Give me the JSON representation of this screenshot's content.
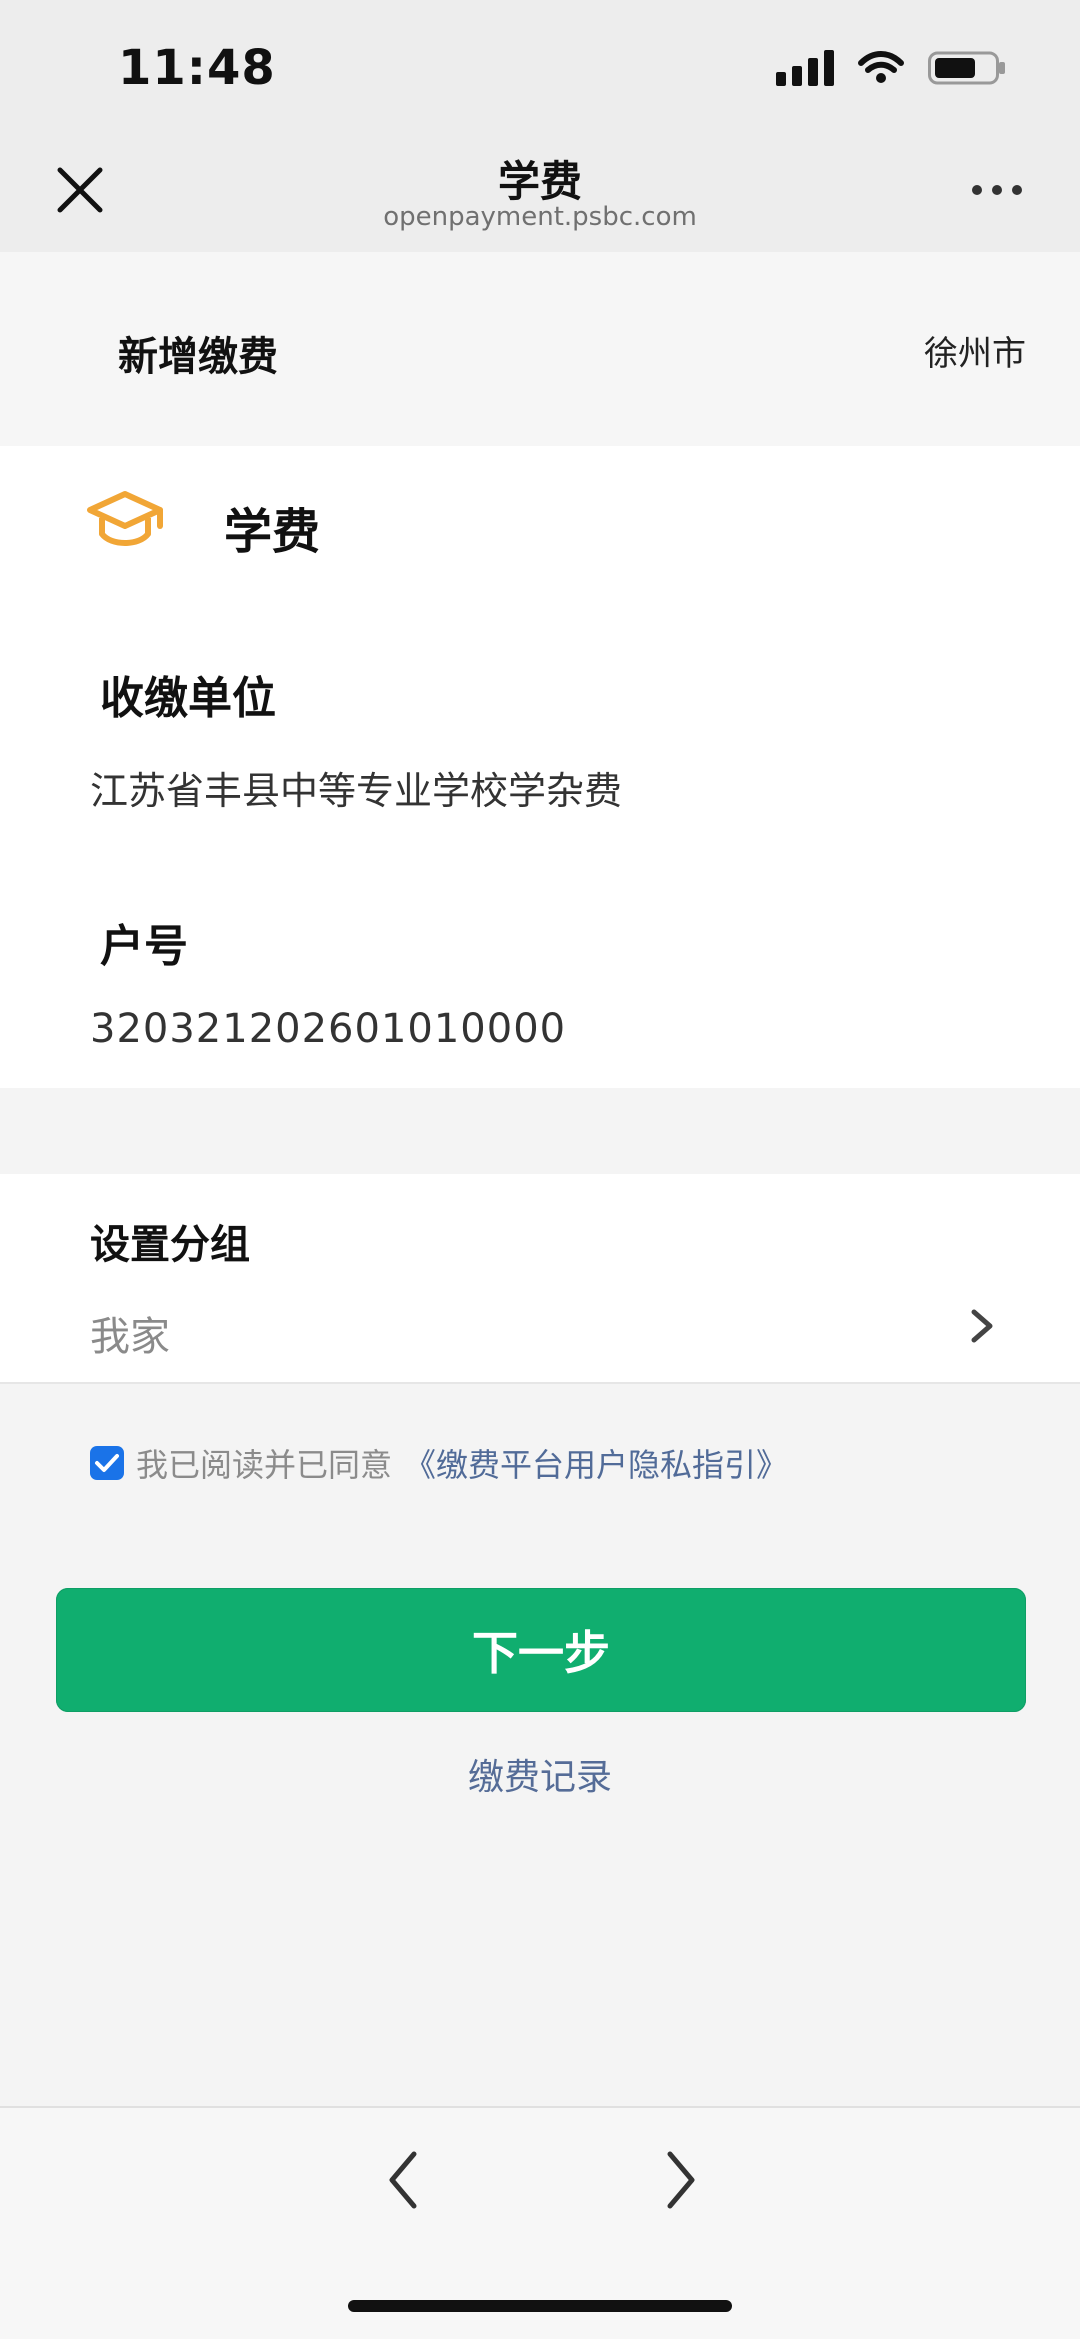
{
  "status": {
    "time": "11:48"
  },
  "header": {
    "title": "学费",
    "url": "openpayment.psbc.com"
  },
  "top": {
    "new_payment": "新增缴费",
    "city": "徐州市"
  },
  "payment_type": {
    "label": "学费",
    "icon": "graduation-cap-icon",
    "icon_color": "#F1A636"
  },
  "unit": {
    "label": "收缴单位",
    "value": "江苏省丰县中等专业学校学杂费"
  },
  "account": {
    "label": "户号",
    "value": "320321202601010000"
  },
  "group": {
    "label": "设置分组",
    "value": "我家"
  },
  "agreement": {
    "prefix": "我已阅读并已同意",
    "link": "《缴费平台用户隐私指引》",
    "checked": true
  },
  "actions": {
    "next": "下一步",
    "records": "缴费记录"
  },
  "colors": {
    "primary_green": "#10AE6F",
    "link_blue": "#556C97"
  }
}
